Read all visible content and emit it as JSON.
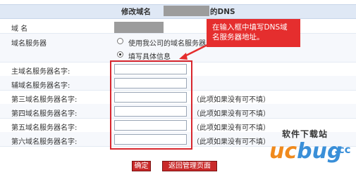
{
  "header": {
    "title_prefix": "修改域名",
    "title_suffix": "的DNS"
  },
  "rows": {
    "domain_label": "域  名",
    "dns_server_label": "域名服务器",
    "option_default": "使用我公司的域名服务器",
    "option_custom": "填写具体信息",
    "ns1_label": "主域名服务器名字:",
    "ns2_label": "辅域名服务器名字:",
    "ns3_label": "第三域名服务器名字:",
    "ns4_label": "第四域名服务器名字:",
    "ns5_label": "第五域名服务器名字:",
    "ns6_label": "第六域名服务器名字:",
    "optional_hint": "（此项如果没有可不填）"
  },
  "callout": {
    "text": "在输入框中填写DNS域名服务器地址。"
  },
  "buttons": {
    "confirm": "确定",
    "back": "返回管理页面"
  },
  "watermark": {
    "top": "软件下载站",
    "uc": "uc",
    "bug": "bug",
    "cc": ".cc"
  },
  "colors": {
    "accent_red": "#e52e2e",
    "header_bg": "#dfe8f5"
  }
}
